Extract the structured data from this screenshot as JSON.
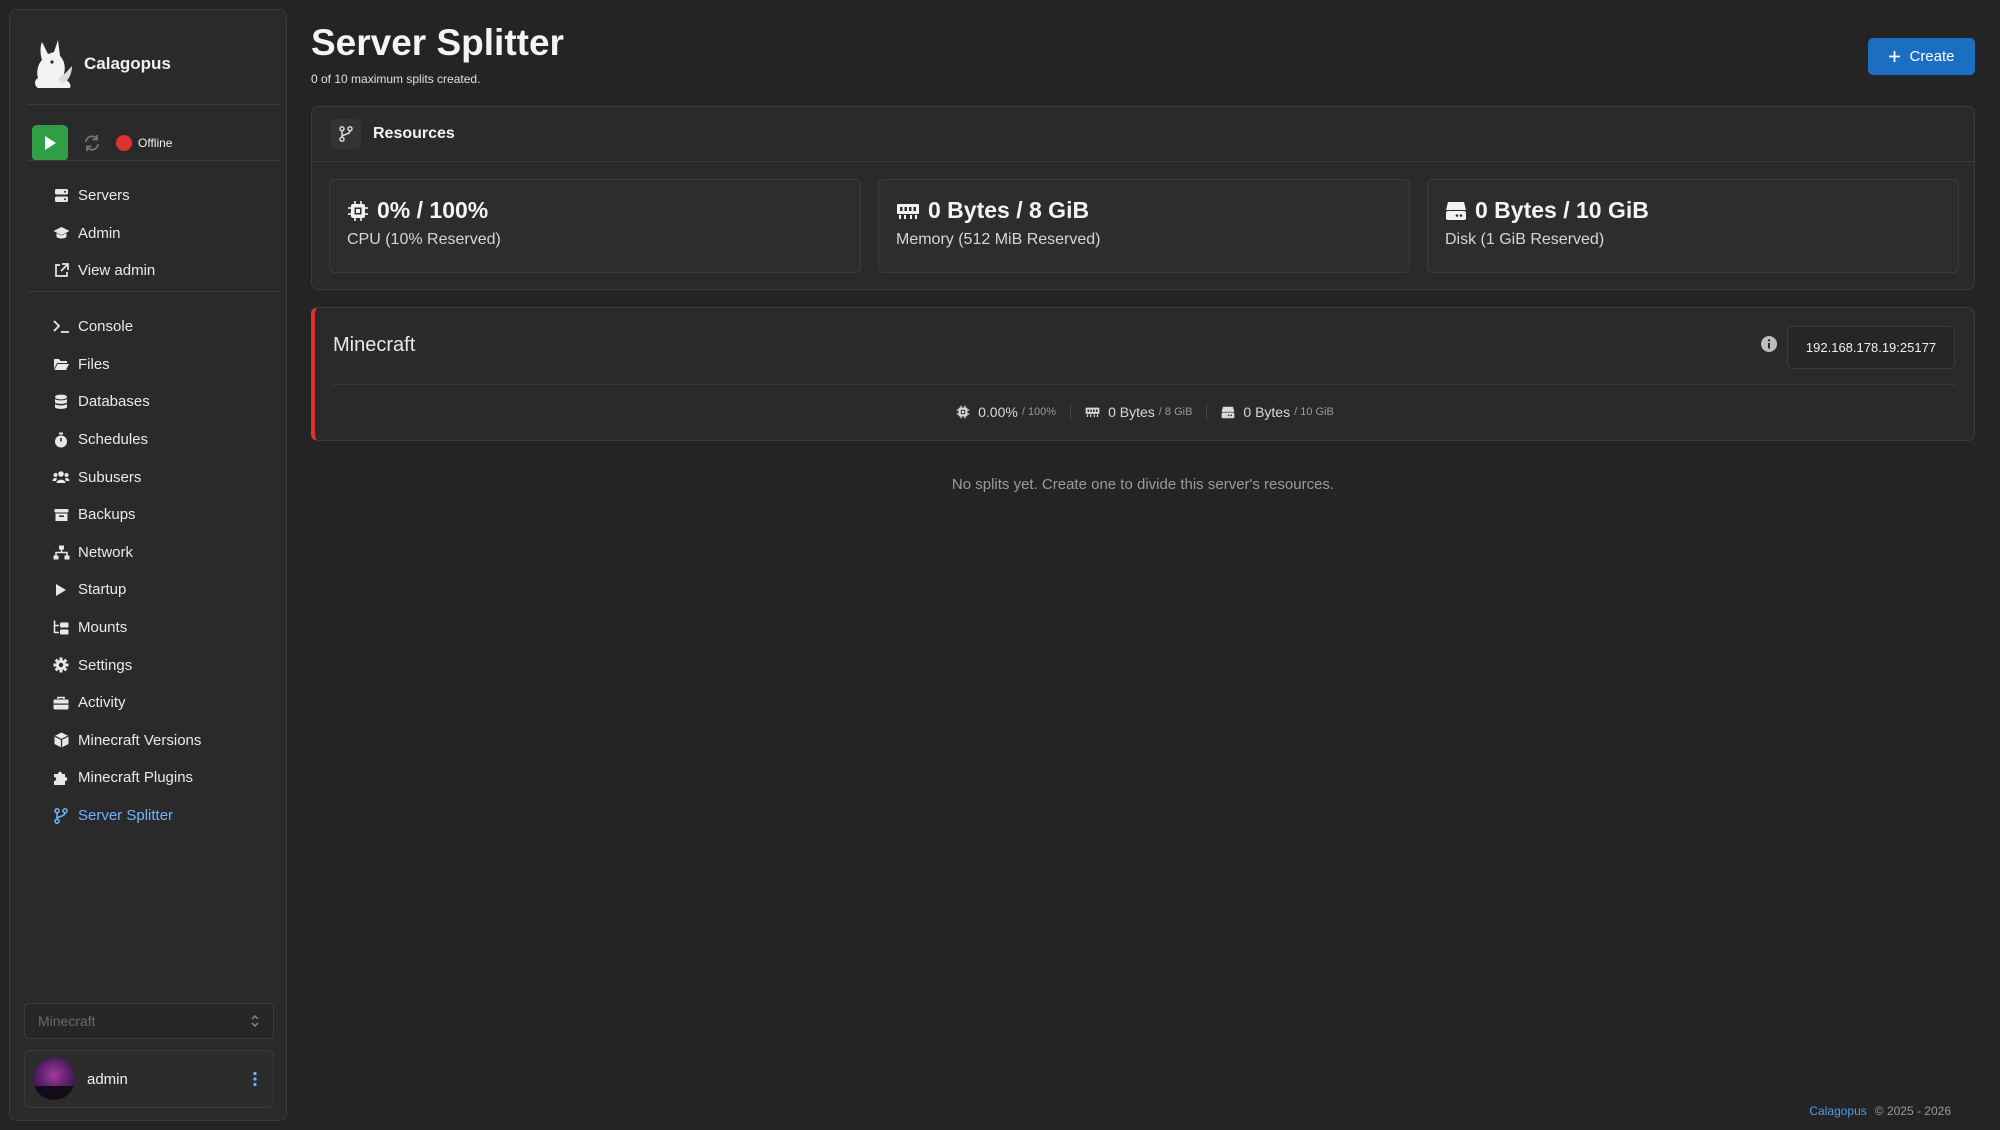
{
  "brand": {
    "name": "Calagopus"
  },
  "power": {
    "status_text": "Offline",
    "status_color": "#e03131"
  },
  "sidebar": {
    "top_items": [
      {
        "label": "Servers",
        "icon": "servers-icon"
      },
      {
        "label": "Admin",
        "icon": "graduation-cap-icon"
      },
      {
        "label": "View admin",
        "icon": "external-link-icon"
      }
    ],
    "server_items": [
      {
        "label": "Console",
        "icon": "terminal-icon"
      },
      {
        "label": "Files",
        "icon": "folder-icon"
      },
      {
        "label": "Databases",
        "icon": "database-icon"
      },
      {
        "label": "Schedules",
        "icon": "stopwatch-icon"
      },
      {
        "label": "Subusers",
        "icon": "users-icon"
      },
      {
        "label": "Backups",
        "icon": "archive-icon"
      },
      {
        "label": "Network",
        "icon": "network-icon"
      },
      {
        "label": "Startup",
        "icon": "play-icon"
      },
      {
        "label": "Mounts",
        "icon": "folder-tree-icon"
      },
      {
        "label": "Settings",
        "icon": "gear-icon"
      },
      {
        "label": "Activity",
        "icon": "briefcase-icon"
      },
      {
        "label": "Minecraft Versions",
        "icon": "cube-icon"
      },
      {
        "label": "Minecraft Plugins",
        "icon": "puzzle-icon"
      },
      {
        "label": "Server Splitter",
        "icon": "code-branch-icon",
        "active": true
      }
    ],
    "server_select": {
      "value": "Minecraft"
    },
    "user": {
      "name": "admin"
    }
  },
  "main": {
    "title": "Server Splitter",
    "subtitle": "0 of 10 maximum splits created.",
    "create_label": "Create",
    "resources": {
      "title": "Resources",
      "cpu": {
        "value": "0% / 100%",
        "desc": "CPU (10% Reserved)"
      },
      "memory": {
        "value": "0 Bytes / 8 GiB",
        "desc": "Memory (512 MiB Reserved)"
      },
      "disk": {
        "value": "0 Bytes / 10 GiB",
        "desc": "Disk (1 GiB Reserved)"
      }
    },
    "server": {
      "name": "Minecraft",
      "address": "192.168.178.19:25177",
      "cpu": {
        "value": "0.00%",
        "limit": "/ 100%"
      },
      "memory": {
        "value": "0 Bytes",
        "limit": "/ 8 GiB"
      },
      "disk": {
        "value": "0 Bytes",
        "limit": "/ 10 GiB"
      },
      "status_color": "#e03131"
    },
    "empty_message": "No splits yet. Create one to divide this server's resources."
  },
  "footer": {
    "brand_link": "Calagopus",
    "copyright": "© 2025 - 2026"
  },
  "colors": {
    "accent": "#1b6ec2",
    "active_nav": "#6fb3ff",
    "play": "#2f9e44"
  }
}
